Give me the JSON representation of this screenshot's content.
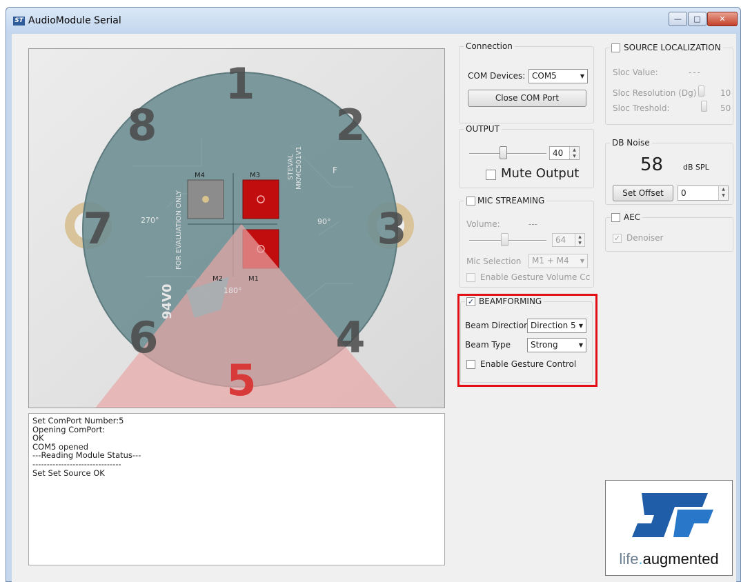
{
  "window": {
    "title": "AudioModule Serial",
    "icon": "st-app-icon",
    "buttons": {
      "minimize": "—",
      "maximize": "□",
      "close": "✕"
    }
  },
  "image": {
    "mic_labels": [
      "1",
      "2",
      "3",
      "4",
      "5",
      "6",
      "7",
      "8"
    ],
    "board_labels": {
      "m1": "M1",
      "m2": "M2",
      "m3": "M3",
      "m4": "M4",
      "deg270": "270°",
      "deg90": "90°",
      "deg180": "180°",
      "part": "STEVAL",
      "part2": "MKMC501V1",
      "eval": "FOR EVALUATION ONLY",
      "v0": "94V0",
      "side": "F"
    },
    "active_direction": "5",
    "colors": {
      "active": "#d83a3a",
      "inactive": "#4a4a4a",
      "beam": "#e8a6a6",
      "board": "#6f8f93",
      "mic_on": "#c10d0d"
    }
  },
  "log": {
    "lines": [
      "Set ComPort Number:5",
      "Opening ComPort:",
      "OK",
      "COM5 opened",
      "---Reading Module Status---",
      "-------------------------------",
      "Set Set Source OK"
    ]
  },
  "connection": {
    "title": "Connection",
    "com_devices_label": "COM Devices:",
    "com_device_value": "COM5",
    "close_port_label": "Close COM Port"
  },
  "output": {
    "title": "OUTPUT",
    "level": 40,
    "level_text": "40",
    "mute_label": "Mute Output",
    "mute_checked": false
  },
  "mic_streaming": {
    "title": "MIC STREAMING",
    "checked": false,
    "volume_label": "Volume:",
    "volume_readout": "---",
    "volume_value": "64",
    "mic_selection_label": "Mic Selection",
    "mic_selection_value": "M1 + M4",
    "gesture_volume_label": "Enable Gesture Volume Cc"
  },
  "beamforming": {
    "title": "BEAMFORMING",
    "checked": true,
    "beam_direction_label": "Beam Directior",
    "beam_direction_value": "Direction 5",
    "beam_type_label": "Beam Type",
    "beam_type_value": "Strong",
    "gesture_label": "Enable Gesture Control",
    "highlight_color": "#e30e15"
  },
  "source_localization": {
    "title": "SOURCE LOCALIZATION",
    "checked": false,
    "sloc_value_label": "Sloc Value:",
    "sloc_value": "---",
    "resolution_label": "Sloc Resolution (Dg)",
    "resolution_value": "10",
    "threshold_label": "Sloc Treshold:",
    "threshold_value": "50"
  },
  "db_noise": {
    "title": "DB Noise",
    "value": "58",
    "unit": "dB SPL",
    "set_offset_label": "Set Offset",
    "offset_value": "0"
  },
  "aec": {
    "title": "AEC",
    "checked": false,
    "denoiser_label": "Denoiser",
    "denoiser_checked": true
  },
  "logo": {
    "mark": "ST",
    "tagline_a": "life",
    "tagline_dot": ".",
    "tagline_b": "augmented"
  }
}
